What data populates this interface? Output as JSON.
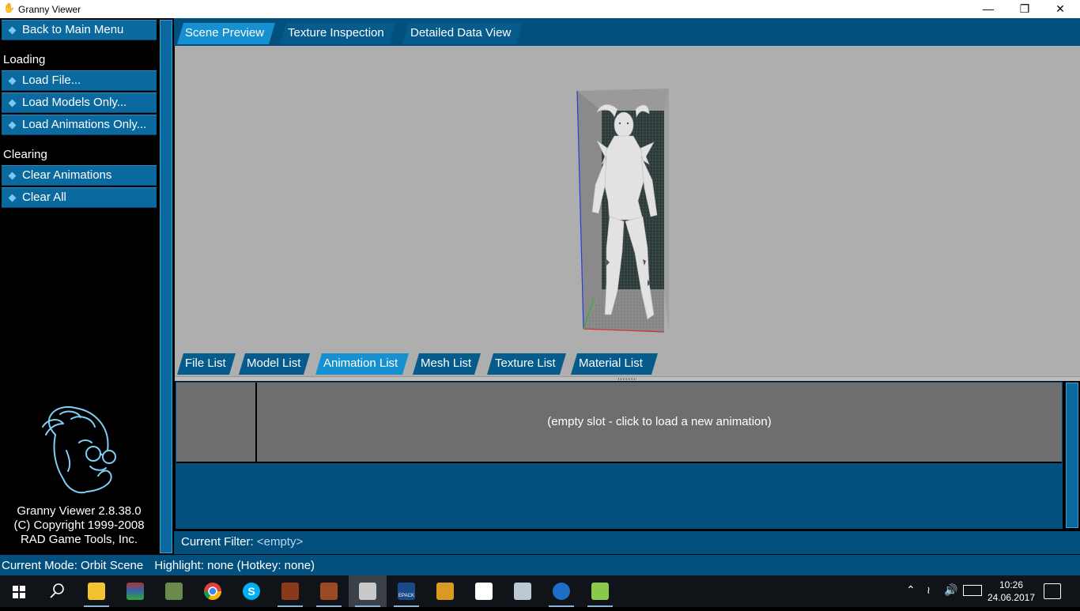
{
  "window": {
    "title": "Granny Viewer"
  },
  "sidebar": {
    "back_label": "Back to Main Menu",
    "loading_heading": "Loading",
    "load_file": "Load File...",
    "load_models": "Load Models Only...",
    "load_animations": "Load Animations Only...",
    "clearing_heading": "Clearing",
    "clear_animations": "Clear Animations",
    "clear_all": "Clear All",
    "about_line1": "Granny Viewer 2.8.38.0",
    "about_line2": "(C) Copyright 1999-2008",
    "about_line3": "RAD Game Tools, Inc."
  },
  "top_tabs": [
    "Scene Preview",
    "Texture Inspection",
    "Detailed Data View"
  ],
  "top_tab_active": "Scene Preview",
  "bottom_tabs": [
    "File List",
    "Model List",
    "Animation List",
    "Mesh List",
    "Texture List",
    "Material List"
  ],
  "bottom_tab_active": "Animation List",
  "animation_slot": {
    "text": "(empty slot - click to load a new animation)"
  },
  "filter": {
    "label": "Current Filter:",
    "value": "<empty>"
  },
  "status": {
    "mode": "Current Mode: Orbit Scene",
    "highlight": "Highlight: none (Hotkey: none)"
  },
  "colors": {
    "panel_blue": "#03507f",
    "button_blue": "#0a6aa0",
    "active_tab": "#1690d0",
    "scene_bg": "#aeaeae"
  },
  "taskbar": {
    "icons": [
      "windows-start-icon",
      "search-icon",
      "file-explorer-icon",
      "winrar-icon",
      "network-app-icon",
      "chrome-icon",
      "skype-icon",
      "game-avatar-icon",
      "game-avatar-icon-2",
      "granny-viewer-icon",
      "epack-icon",
      "metin2-icon",
      "photos-icon",
      "image-viewer-icon",
      "app-icon",
      "notepad-icon"
    ],
    "epack_label": "EPACK",
    "time": "10:26",
    "date": "24.06.2017"
  }
}
